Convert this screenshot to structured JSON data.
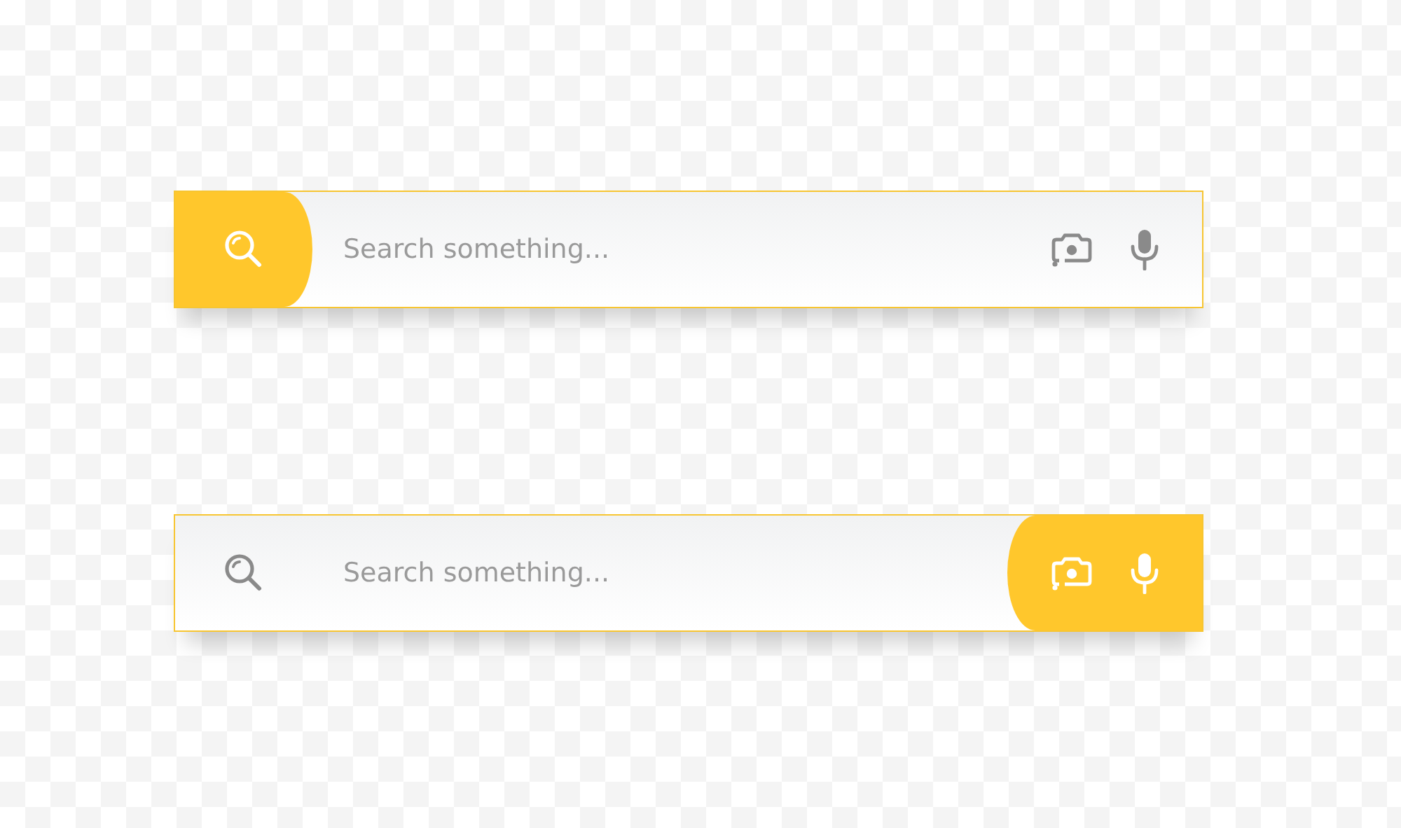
{
  "search_bars": [
    {
      "kind": "accent-left",
      "placeholder": "Search something..."
    },
    {
      "kind": "accent-right",
      "placeholder": "Search something..."
    }
  ]
}
